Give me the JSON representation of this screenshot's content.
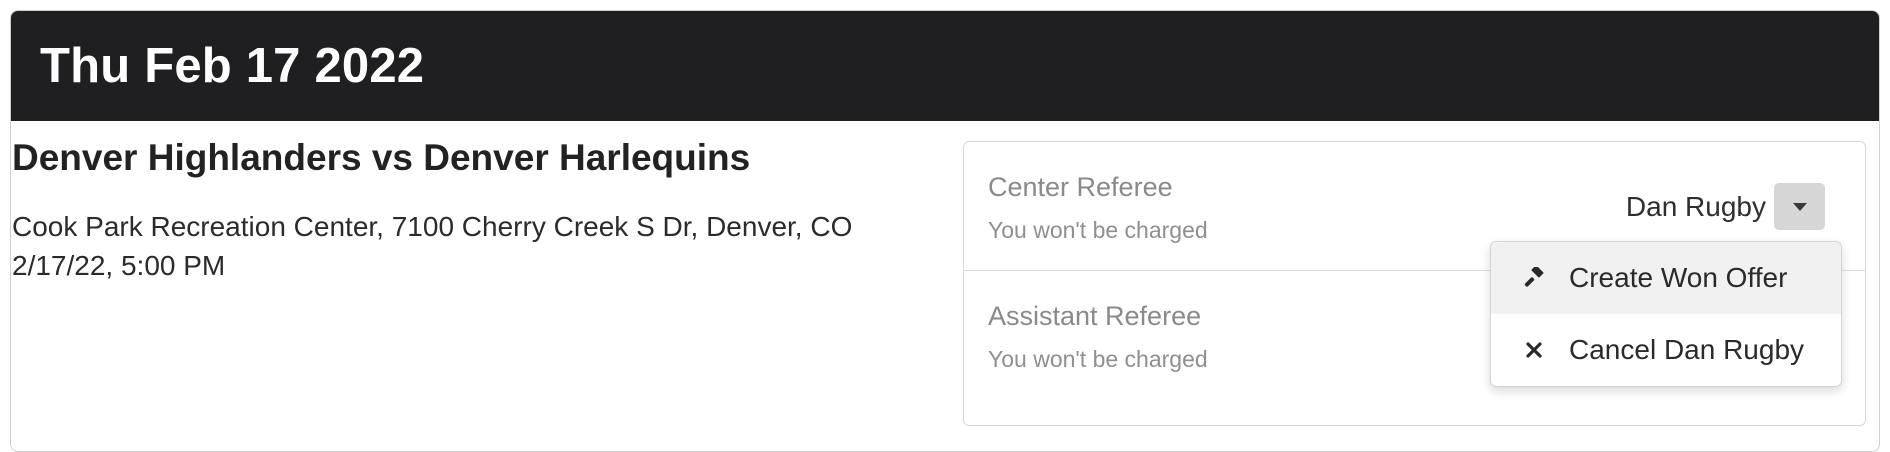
{
  "header": {
    "date": "Thu Feb 17 2022"
  },
  "game": {
    "title": "Denver Highlanders vs Denver Harlequins",
    "location": "Cook Park Recreation Center, 7100 Cherry Creek S Dr, Denver, CO",
    "datetime": "2/17/22, 5:00 PM"
  },
  "slots": [
    {
      "role": "Center Referee",
      "note": "You won't be charged",
      "assignee": "Dan Rugby"
    },
    {
      "role": "Assistant Referee",
      "note": "You won't be charged"
    }
  ],
  "dropdown": {
    "items": [
      {
        "label": "Create Won Offer",
        "icon": "gavel-icon"
      },
      {
        "label": "Cancel Dan Rugby",
        "icon": "close-icon"
      }
    ]
  },
  "colors": {
    "header_bg": "#1f1f21",
    "caret_button_bg": "#d6d6d6",
    "menu_hover_bg": "#f1f1f1"
  }
}
